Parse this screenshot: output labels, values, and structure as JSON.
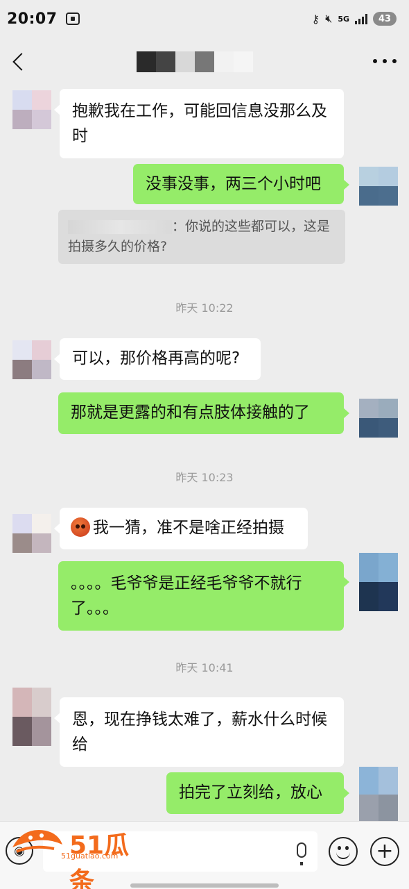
{
  "status_bar": {
    "time": "20:07",
    "network": "5G",
    "battery": "43",
    "icons": [
      "screen-record-icon",
      "key-icon",
      "mute-icon",
      "signal-icon",
      "battery-icon"
    ]
  },
  "header": {
    "back_icon": "chevron-left-icon",
    "more_icon": "more-dots-icon",
    "title_mosaic_colors": [
      "#2a2a2a",
      "#444444",
      "#d8d8d8",
      "#777777",
      "#f2f2f2",
      "#f5f5f5",
      "#ededed"
    ]
  },
  "messages": [
    {
      "side": "in",
      "text": "抱歉我在工作，可能回信息没那么及时"
    },
    {
      "side": "out",
      "text": "没事没事，两三个小时吧"
    },
    {
      "side": "quote",
      "text": "：你说的这些都可以，这是拍摄多久的价格?"
    },
    {
      "side": "time",
      "text": "昨天 10:22"
    },
    {
      "side": "in",
      "text": "可以，那价格再高的呢?"
    },
    {
      "side": "out",
      "text": "那就是更露的和有点肢体接触的了"
    },
    {
      "side": "time",
      "text": "昨天 10:23"
    },
    {
      "side": "in",
      "text": "我一猜，准不是啥正经拍摄",
      "emoji": "angry-face-emoji"
    },
    {
      "side": "out",
      "text": "。。。。毛爷爷是正经毛爷爷不就行了。。。"
    },
    {
      "side": "time",
      "text": "昨天 10:41"
    },
    {
      "side": "in",
      "text": "恩，现在挣钱太难了，薪水什么时候给"
    },
    {
      "side": "out",
      "text": "拍完了立刻给，放心"
    }
  ],
  "avatars": {
    "in_1": [
      "#d8dcf0",
      "#ecd4dc",
      "#bdaebe",
      "#d4c8d8"
    ],
    "in_2": [
      "#e4e6f2",
      "#e6cdd6",
      "#8c7c80",
      "#c0b8c6"
    ],
    "in_3": [
      "#dcdcf0",
      "#f4f0ec",
      "#9b8c8a",
      "#c4b6be"
    ],
    "in_4": [
      "#d4b6b8",
      "#d8cccc",
      "#6a5a60",
      "#a4949c"
    ],
    "out_1": [
      "#b8d0e0",
      "#b4cce0",
      "#4a6c8c",
      "#4c6e8e"
    ],
    "out_2": [
      "#a4b0c0",
      "#9aacbc",
      "#3a5878",
      "#3e5c7c"
    ],
    "out_3": [
      "#7aa6cc",
      "#84b0d4",
      "#1e3450",
      "#22385a"
    ],
    "out_4": [
      "#8cb4d8",
      "#a4c0dc",
      "#9aa0ac",
      "#8c94a0"
    ]
  },
  "input_bar": {
    "voice_icon": "voice-icon",
    "mic_icon": "mic-icon",
    "emoji_icon": "emoji-icon",
    "plus_icon": "plus-icon"
  },
  "watermark": {
    "text": "51瓜条",
    "sub": "51guatiao.com",
    "color": "#f36b1c"
  },
  "colors": {
    "background": "#ededed",
    "incoming_bubble": "#ffffff",
    "outgoing_bubble": "#95ec69",
    "timestamp": "#9a9a9a"
  }
}
